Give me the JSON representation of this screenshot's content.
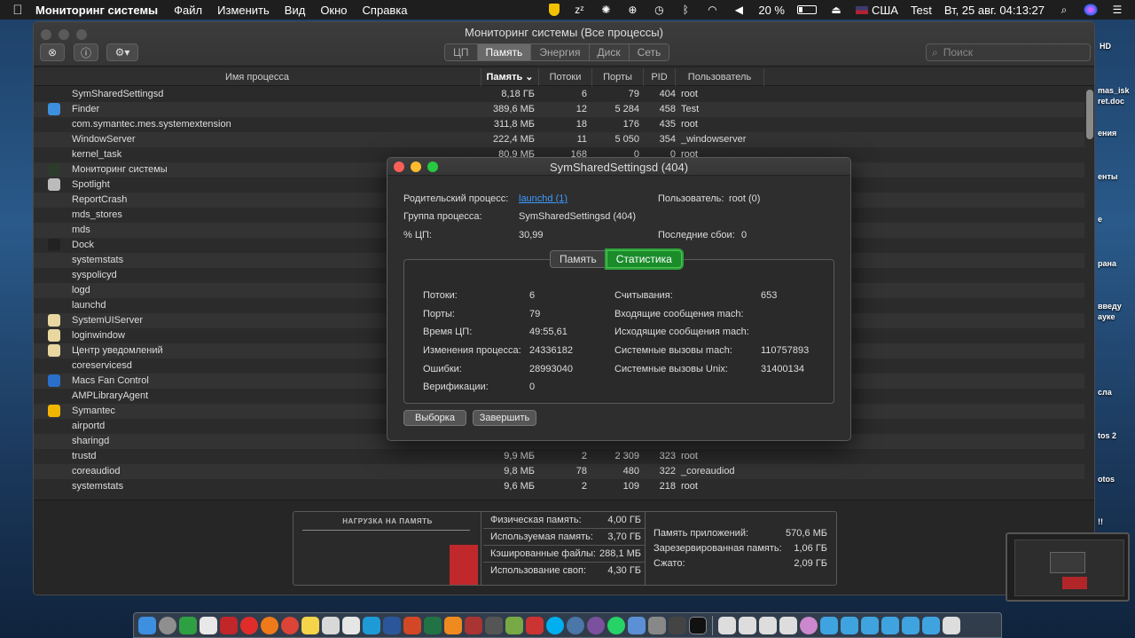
{
  "menubar": {
    "apple": "",
    "app_name": "Мониторинг системы",
    "items": [
      "Файл",
      "Изменить",
      "Вид",
      "Окно",
      "Справка"
    ],
    "battery": "20 %",
    "input_source": "США",
    "user": "Test",
    "clock": "Вт, 25 авг.  04:13:27"
  },
  "window": {
    "title": "Мониторинг системы (Все процессы)",
    "tabs": [
      "ЦП",
      "Память",
      "Энергия",
      "Диск",
      "Сеть"
    ],
    "active_tab": "Память",
    "search_placeholder": "Поиск"
  },
  "table": {
    "headers": {
      "name": "Имя процесса",
      "memory": "Память",
      "threads": "Потоки",
      "ports": "Порты",
      "pid": "PID",
      "user": "Пользователь"
    },
    "rows": [
      {
        "name": "SymSharedSettingsd",
        "memory": "8,18 ГБ",
        "threads": "6",
        "ports": "79",
        "pid": "404",
        "user": "root",
        "icon": ""
      },
      {
        "name": "Finder",
        "memory": "389,6 МБ",
        "threads": "12",
        "ports": "5 284",
        "pid": "458",
        "user": "Test",
        "icon": "finder-icon"
      },
      {
        "name": "com.symantec.mes.systemextension",
        "memory": "311,8 МБ",
        "threads": "18",
        "ports": "176",
        "pid": "435",
        "user": "root",
        "icon": ""
      },
      {
        "name": "WindowServer",
        "memory": "222,4 МБ",
        "threads": "11",
        "ports": "5 050",
        "pid": "354",
        "user": "_windowserver",
        "icon": ""
      },
      {
        "name": "kernel_task",
        "memory": "80,9 МБ",
        "threads": "168",
        "ports": "0",
        "pid": "0",
        "user": "root",
        "icon": ""
      },
      {
        "name": "Мониторинг системы",
        "memory": "",
        "threads": "",
        "ports": "",
        "pid": "",
        "user": "",
        "icon": "activity-monitor-icon"
      },
      {
        "name": "Spotlight",
        "memory": "",
        "threads": "",
        "ports": "",
        "pid": "",
        "user": "",
        "icon": "spotlight-icon"
      },
      {
        "name": "ReportCrash",
        "memory": "",
        "threads": "",
        "ports": "",
        "pid": "",
        "user": "",
        "icon": ""
      },
      {
        "name": "mds_stores",
        "memory": "",
        "threads": "",
        "ports": "",
        "pid": "",
        "user": "",
        "icon": ""
      },
      {
        "name": "mds",
        "memory": "",
        "threads": "",
        "ports": "",
        "pid": "",
        "user": "",
        "icon": ""
      },
      {
        "name": "Dock",
        "memory": "",
        "threads": "",
        "ports": "",
        "pid": "",
        "user": "",
        "icon": "dock-icon"
      },
      {
        "name": "systemstats",
        "memory": "",
        "threads": "",
        "ports": "",
        "pid": "",
        "user": "",
        "icon": ""
      },
      {
        "name": "syspolicyd",
        "memory": "",
        "threads": "",
        "ports": "",
        "pid": "",
        "user": "",
        "icon": ""
      },
      {
        "name": "logd",
        "memory": "",
        "threads": "",
        "ports": "",
        "pid": "",
        "user": "",
        "icon": ""
      },
      {
        "name": "launchd",
        "memory": "",
        "threads": "",
        "ports": "",
        "pid": "",
        "user": "",
        "icon": ""
      },
      {
        "name": "SystemUIServer",
        "memory": "",
        "threads": "",
        "ports": "",
        "pid": "",
        "user": "",
        "icon": "systemuiserver-icon"
      },
      {
        "name": "loginwindow",
        "memory": "",
        "threads": "",
        "ports": "",
        "pid": "",
        "user": "",
        "icon": "loginwindow-icon"
      },
      {
        "name": "Центр уведомлений",
        "memory": "",
        "threads": "",
        "ports": "",
        "pid": "",
        "user": "",
        "icon": "notification-center-icon"
      },
      {
        "name": "coreservicesd",
        "memory": "",
        "threads": "",
        "ports": "",
        "pid": "",
        "user": "",
        "icon": ""
      },
      {
        "name": "Macs Fan Control",
        "memory": "",
        "threads": "",
        "ports": "",
        "pid": "",
        "user": "",
        "icon": "fan-control-icon"
      },
      {
        "name": "AMPLibraryAgent",
        "memory": "",
        "threads": "",
        "ports": "",
        "pid": "",
        "user": "",
        "icon": ""
      },
      {
        "name": "Symantec",
        "memory": "",
        "threads": "",
        "ports": "",
        "pid": "",
        "user": "",
        "icon": "symantec-icon"
      },
      {
        "name": "airportd",
        "memory": "",
        "threads": "",
        "ports": "",
        "pid": "",
        "user": "",
        "icon": ""
      },
      {
        "name": "sharingd",
        "memory": "",
        "threads": "",
        "ports": "",
        "pid": "",
        "user": "",
        "icon": ""
      },
      {
        "name": "trustd",
        "memory": "9,9 МБ",
        "threads": "2",
        "ports": "2 309",
        "pid": "323",
        "user": "root",
        "icon": ""
      },
      {
        "name": "coreaudiod",
        "memory": "9,8 МБ",
        "threads": "78",
        "ports": "480",
        "pid": "322",
        "user": "_coreaudiod",
        "icon": ""
      },
      {
        "name": "systemstats",
        "memory": "9,6 МБ",
        "threads": "2",
        "ports": "109",
        "pid": "218",
        "user": "root",
        "icon": ""
      }
    ]
  },
  "memory_panel": {
    "pressure_label": "НАГРУЗКА НА ПАМЯТЬ",
    "pressure_level": 0.55,
    "left": [
      {
        "k": "Физическая память:",
        "v": "4,00 ГБ"
      },
      {
        "k": "Используемая память:",
        "v": "3,70 ГБ"
      },
      {
        "k": "Кэшированные файлы:",
        "v": "288,1 МБ"
      },
      {
        "k": "Использование своп:",
        "v": "4,30 ГБ"
      }
    ],
    "right": [
      {
        "k": "Память приложений:",
        "v": "570,6 МБ"
      },
      {
        "k": "Зарезервированная память:",
        "v": "1,06 ГБ"
      },
      {
        "k": "Сжато:",
        "v": "2,09 ГБ"
      }
    ]
  },
  "dialog": {
    "title": "SymSharedSettingsd (404)",
    "parent_label": "Родительский процесс:",
    "parent_value": "launchd (1)",
    "user_label": "Пользователь:",
    "user_value": "root (0)",
    "group_label": "Группа процесса:",
    "group_value": "SymSharedSettingsd (404)",
    "cpu_label": "% ЦП:",
    "cpu_value": "30,99",
    "crashes_label": "Последние сбои:",
    "crashes_value": "0",
    "tabs": [
      "Память",
      "Статистика"
    ],
    "active_tab": "Статистика",
    "stats_left": [
      {
        "k": "Потоки:",
        "v": "6"
      },
      {
        "k": "Порты:",
        "v": "79"
      },
      {
        "k": "Время ЦП:",
        "v": "49:55,61"
      },
      {
        "k": "Изменения процесса:",
        "v": "24336182"
      },
      {
        "k": "Ошибки:",
        "v": "28993040"
      },
      {
        "k": "Верификации:",
        "v": "0"
      }
    ],
    "stats_right": [
      {
        "k": "Считывания:",
        "v": "653"
      },
      {
        "k": "Входящие сообщения mach:",
        "v": ""
      },
      {
        "k": "Исходящие сообщения mach:",
        "v": ""
      },
      {
        "k": "Системные вызовы mach:",
        "v": "110757893"
      },
      {
        "k": "Системные вызовы Unix:",
        "v": "31400134"
      }
    ],
    "sample_button": "Выборка",
    "quit_button": "Завершить"
  },
  "desktop_labels": [
    "HD",
    "mas_isk",
    "ret.doc",
    "ения",
    "енты",
    "е",
    "рана",
    "введу",
    "ауке",
    "сла",
    "tos 2",
    "otos",
    "!!"
  ],
  "colors": {
    "accent_green": "#1a8c2a",
    "link": "#3d9bff",
    "pressure": "#c0282c",
    "desktop": "#2a5a8a"
  }
}
